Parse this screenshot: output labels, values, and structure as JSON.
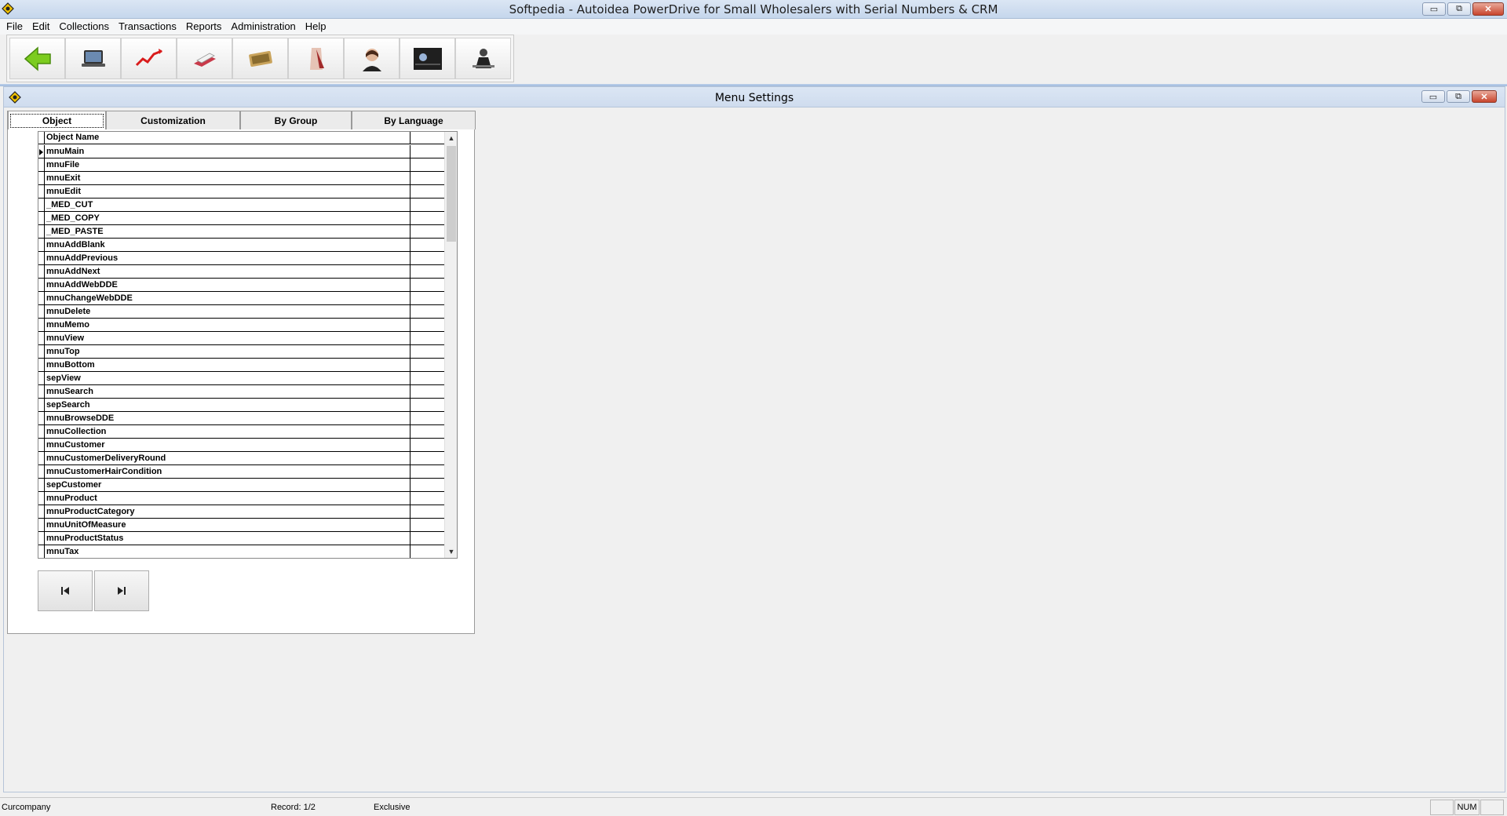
{
  "window": {
    "title": "Softpedia - Autoidea PowerDrive for Small Wholesalers with Serial Numbers & CRM",
    "minimize": "▭",
    "restore": "⧉",
    "close": "✕"
  },
  "menu": [
    "File",
    "Edit",
    "Collections",
    "Transactions",
    "Reports",
    "Administration",
    "Help"
  ],
  "toolbar": {
    "buttons": [
      "back-arrow-icon",
      "laptop-icon",
      "chart-trend-icon",
      "document-icon",
      "money-icon",
      "person-icon",
      "support-agent-icon",
      "keyboard-icon",
      "user-desk-icon"
    ]
  },
  "child": {
    "title": "Menu Settings",
    "minimize": "▭",
    "restore": "⧉",
    "close": "✕"
  },
  "tabs": [
    "Object",
    "Customization",
    "By Group",
    "By Language"
  ],
  "grid": {
    "header": "Object Name",
    "rows": [
      "mnuMain",
      "mnuFile",
      "mnuExit",
      "mnuEdit",
      "_MED_CUT",
      "_MED_COPY",
      "_MED_PASTE",
      "mnuAddBlank",
      "mnuAddPrevious",
      "mnuAddNext",
      "mnuAddWebDDE",
      "mnuChangeWebDDE",
      "mnuDelete",
      "mnuMemo",
      "mnuView",
      "mnuTop",
      "mnuBottom",
      "sepView",
      "mnuSearch",
      "sepSearch",
      "mnuBrowseDDE",
      "mnuCollection",
      "mnuCustomer",
      "mnuCustomerDeliveryRound",
      "mnuCustomerHairCondition",
      "sepCustomer",
      "mnuProduct",
      "mnuProductCategory",
      "mnuUnitOfMeasure",
      "mnuProductStatus",
      "mnuTax"
    ]
  },
  "status": {
    "company": "Curcompany",
    "record": "Record: 1/2",
    "mode": "Exclusive",
    "num": "NUM"
  },
  "colors": {
    "titlebar": "#c5d6ec",
    "close": "#c8452d"
  }
}
